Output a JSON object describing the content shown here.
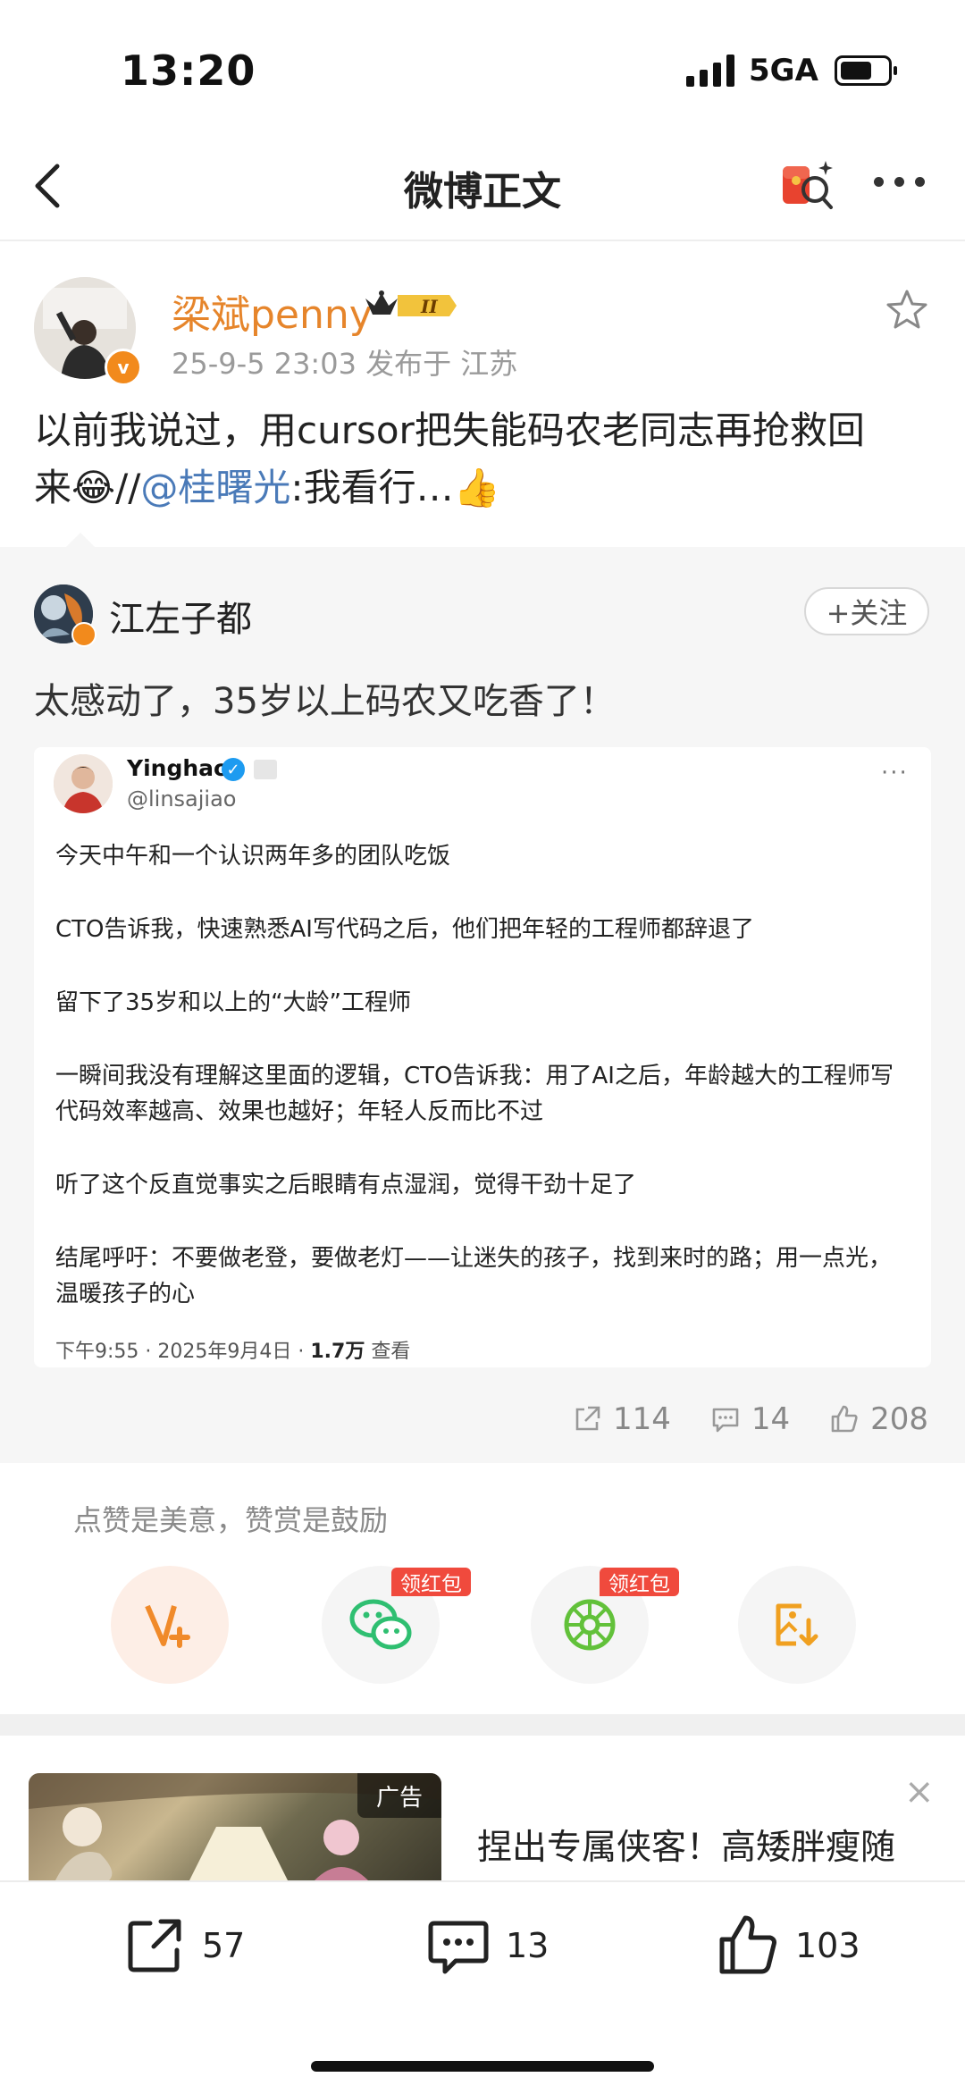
{
  "status_bar": {
    "time": "13:20",
    "network": "5GA"
  },
  "nav": {
    "title": "微博正文"
  },
  "post": {
    "username": "梁斌penny",
    "vip_level": "II",
    "meta": "25-9-5 23:03  发布于 江苏",
    "text_line1": "以前我说过，用cursor把失能码农老同志再抢救回",
    "text_line2_prefix": "来",
    "text_emoji": "😂",
    "text_sep": "//",
    "mention": "@桂曙光",
    "text_line2_suffix": ":我看行…",
    "text_end_emoji": "👍"
  },
  "repost": {
    "author": "江左子都",
    "follow_label": "+关注",
    "text": "太感动了，35岁以上码农又吃香了！",
    "embedded": {
      "name": "Yinghao",
      "handle": "@linsajiao",
      "more": "···",
      "paragraphs": [
        "今天中午和一个认识两年多的团队吃饭",
        "CTO告诉我，快速熟悉AI写代码之后，他们把年轻的工程师都辞退了",
        "留下了35岁和以上的“大龄”工程师",
        "一瞬间我没有理解这里面的逻辑，CTO告诉我：用了AI之后，年龄越大的工程师写代码效率越高、效果也越好；年轻人反而比不过",
        "听了这个反直觉事实之后眼睛有点湿润，觉得干劲十足了",
        "结尾呼吁：不要做老登，要做老灯——让迷失的孩子，找到来时的路；用一点光，温暖孩子的心"
      ],
      "meta_prefix": "下午9:55 · 2025年9月4日 · ",
      "views": "1.7万",
      "views_label": " 查看"
    },
    "counts": {
      "share": "114",
      "comment": "14",
      "like": "208"
    }
  },
  "reward": {
    "label": "点赞是美意，赞赏是鼓励",
    "tag_wechat": "领红包",
    "tag_moments": "领红包"
  },
  "ad": {
    "tag": "广告",
    "text": "捏出专属侠客！高矮胖瘦随",
    "close": "×"
  },
  "bottom_bar": {
    "share": "57",
    "comment": "13",
    "like": "103"
  },
  "colors": {
    "orange": "#e6852b",
    "link": "#4a7ab8",
    "red_tag": "#f04a3d",
    "wechat_green": "#2fbf71"
  }
}
